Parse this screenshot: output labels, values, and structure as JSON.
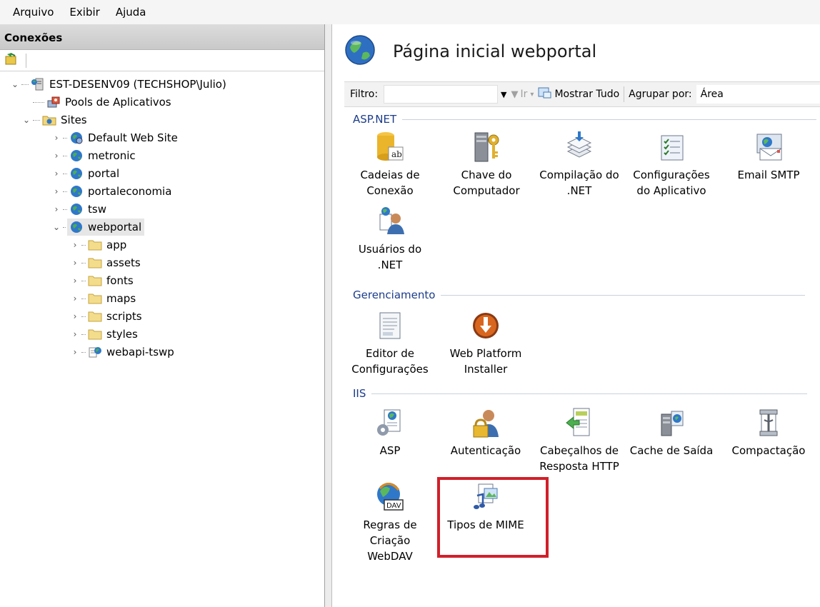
{
  "menu": [
    "Arquivo",
    "Exibir",
    "Ajuda"
  ],
  "connections": {
    "header": "Conexões",
    "tree": [
      {
        "label": "EST-DESENV09 (TECHSHOP\\Julio)",
        "icon": "server-icon"
      },
      {
        "label": "Pools de Aplicativos",
        "icon": "app-pool-icon"
      },
      {
        "label": "Sites",
        "icon": "sites-folder-icon"
      },
      {
        "label": "Default Web Site",
        "icon": "globe-icon"
      },
      {
        "label": "metronic",
        "icon": "globe-icon"
      },
      {
        "label": "portal",
        "icon": "globe-icon"
      },
      {
        "label": "portaleconomia",
        "icon": "globe-icon"
      },
      {
        "label": "tsw",
        "icon": "globe-icon"
      },
      {
        "label": "webportal",
        "icon": "globe-icon",
        "selected": true
      },
      {
        "label": "app",
        "icon": "folder-icon"
      },
      {
        "label": "assets",
        "icon": "folder-icon"
      },
      {
        "label": "fonts",
        "icon": "folder-icon"
      },
      {
        "label": "maps",
        "icon": "folder-icon"
      },
      {
        "label": "scripts",
        "icon": "folder-icon"
      },
      {
        "label": "styles",
        "icon": "folder-icon"
      },
      {
        "label": "webapi-tswp",
        "icon": "web-application-icon"
      }
    ]
  },
  "page": {
    "title": "Página inicial webportal"
  },
  "filterbar": {
    "filter_label": "Filtro:",
    "go_label": "Ir",
    "show_all_label": "Mostrar Tudo",
    "group_by_label": "Agrupar por:",
    "group_by_value": "Área"
  },
  "sections": {
    "aspnet": {
      "title": "ASP.NET",
      "items": [
        {
          "l1": "Cadeias de",
          "l2": "Conexão",
          "icon": "connection-strings-icon"
        },
        {
          "l1": "Chave do",
          "l2": "Computador",
          "icon": "machine-key-icon"
        },
        {
          "l1": "Compilação do",
          "l2": ".NET",
          "icon": "net-compilation-icon"
        },
        {
          "l1": "Configurações",
          "l2": "do Aplicativo",
          "icon": "app-settings-icon"
        },
        {
          "l1": "Email SMTP",
          "l2": "",
          "icon": "smtp-email-icon"
        },
        {
          "l1": "Usuários do .NET",
          "l2": "",
          "icon": "net-users-icon"
        }
      ]
    },
    "management": {
      "title": "Gerenciamento",
      "items": [
        {
          "l1": "Editor de",
          "l2": "Configurações",
          "icon": "configuration-editor-icon"
        },
        {
          "l1": "Web Platform",
          "l2": "Installer",
          "icon": "web-platform-installer-icon"
        }
      ]
    },
    "iis": {
      "title": "IIS",
      "items": [
        {
          "l1": "ASP",
          "l2": "",
          "icon": "asp-icon"
        },
        {
          "l1": "Autenticação",
          "l2": "",
          "icon": "authentication-icon"
        },
        {
          "l1": "Cabeçalhos de",
          "l2": "Resposta HTTP",
          "icon": "http-headers-icon"
        },
        {
          "l1": "Cache de Saída",
          "l2": "",
          "icon": "output-cache-icon"
        },
        {
          "l1": "Compactação",
          "l2": "",
          "icon": "compression-icon"
        },
        {
          "l1": "Regras de",
          "l2": "Criação WebDAV",
          "icon": "webdav-icon",
          "badge": "DAV"
        },
        {
          "l1": "Tipos de MIME",
          "l2": "",
          "icon": "mime-types-icon"
        }
      ]
    }
  },
  "colors": {
    "highlight": "#d0202a",
    "section_title": "#1c3c8a"
  }
}
